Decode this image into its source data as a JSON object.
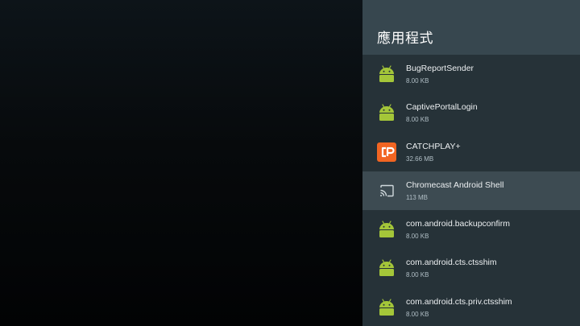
{
  "panel": {
    "title": "應用程式"
  },
  "apps": [
    {
      "name": "BugReportSender",
      "size": "8.00 KB",
      "icon": "android-icon"
    },
    {
      "name": "CaptivePortalLogin",
      "size": "8.00 KB",
      "icon": "android-icon"
    },
    {
      "name": "CATCHPLAY+",
      "size": "32.66 MB",
      "icon": "catchplay-icon",
      "icon_color": "#f26522"
    },
    {
      "name": "Chromecast Android Shell",
      "size": "113 MB",
      "icon": "cast-icon",
      "focused": true
    },
    {
      "name": "com.android.backupconfirm",
      "size": "8.00 KB",
      "icon": "android-icon"
    },
    {
      "name": "com.android.cts.ctsshim",
      "size": "8.00 KB",
      "icon": "android-icon"
    },
    {
      "name": "com.android.cts.priv.ctsshim",
      "size": "8.00 KB",
      "icon": "android-icon"
    }
  ],
  "colors": {
    "panel_bg": "#263238",
    "header_bg": "#37474f",
    "focus_bg": "#3d4b52",
    "android_green": "#a4c639"
  }
}
